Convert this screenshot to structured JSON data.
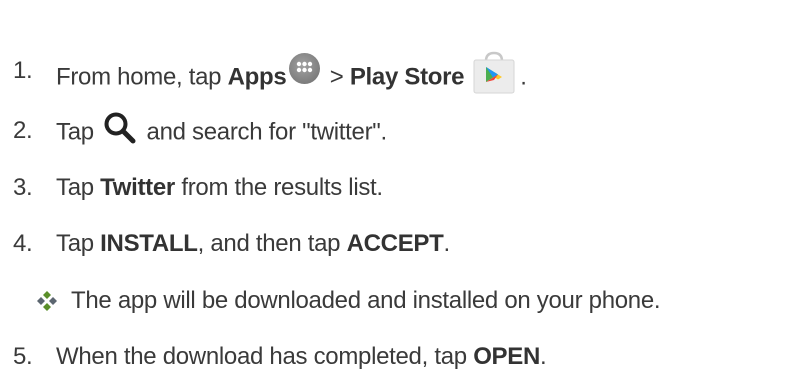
{
  "steps": [
    {
      "number": "1.",
      "text_a": "From home, tap ",
      "bold_a": "Apps",
      "text_b": " > ",
      "bold_b": "Play Store",
      "text_c": ".",
      "icons": [
        "apps-icon",
        "play-store-icon"
      ]
    },
    {
      "number": "2.",
      "text_a": "Tap",
      "text_b": " and search for \"twitter\".",
      "icons": [
        "search-icon"
      ]
    },
    {
      "number": "3.",
      "text_a": "Tap ",
      "bold_a": "Twitter",
      "text_b": " from the results list."
    },
    {
      "number": "4.",
      "text_a": "Tap ",
      "bold_a": "INSTALL",
      "text_b": ", and then tap ",
      "bold_b": "ACCEPT",
      "text_c": "."
    },
    {
      "number": "5.",
      "text_a": "When the download has completed, tap ",
      "bold_a": "OPEN",
      "text_b": "."
    }
  ],
  "note": {
    "icon": "diamond-bullet-icon",
    "text": "The app will be downloaded and installed on your phone."
  },
  "colors": {
    "text": "#3a3a3a",
    "apps_icon": "#808080",
    "bullet_green": "#5a8f2a",
    "bullet_gray": "#5c6670"
  }
}
